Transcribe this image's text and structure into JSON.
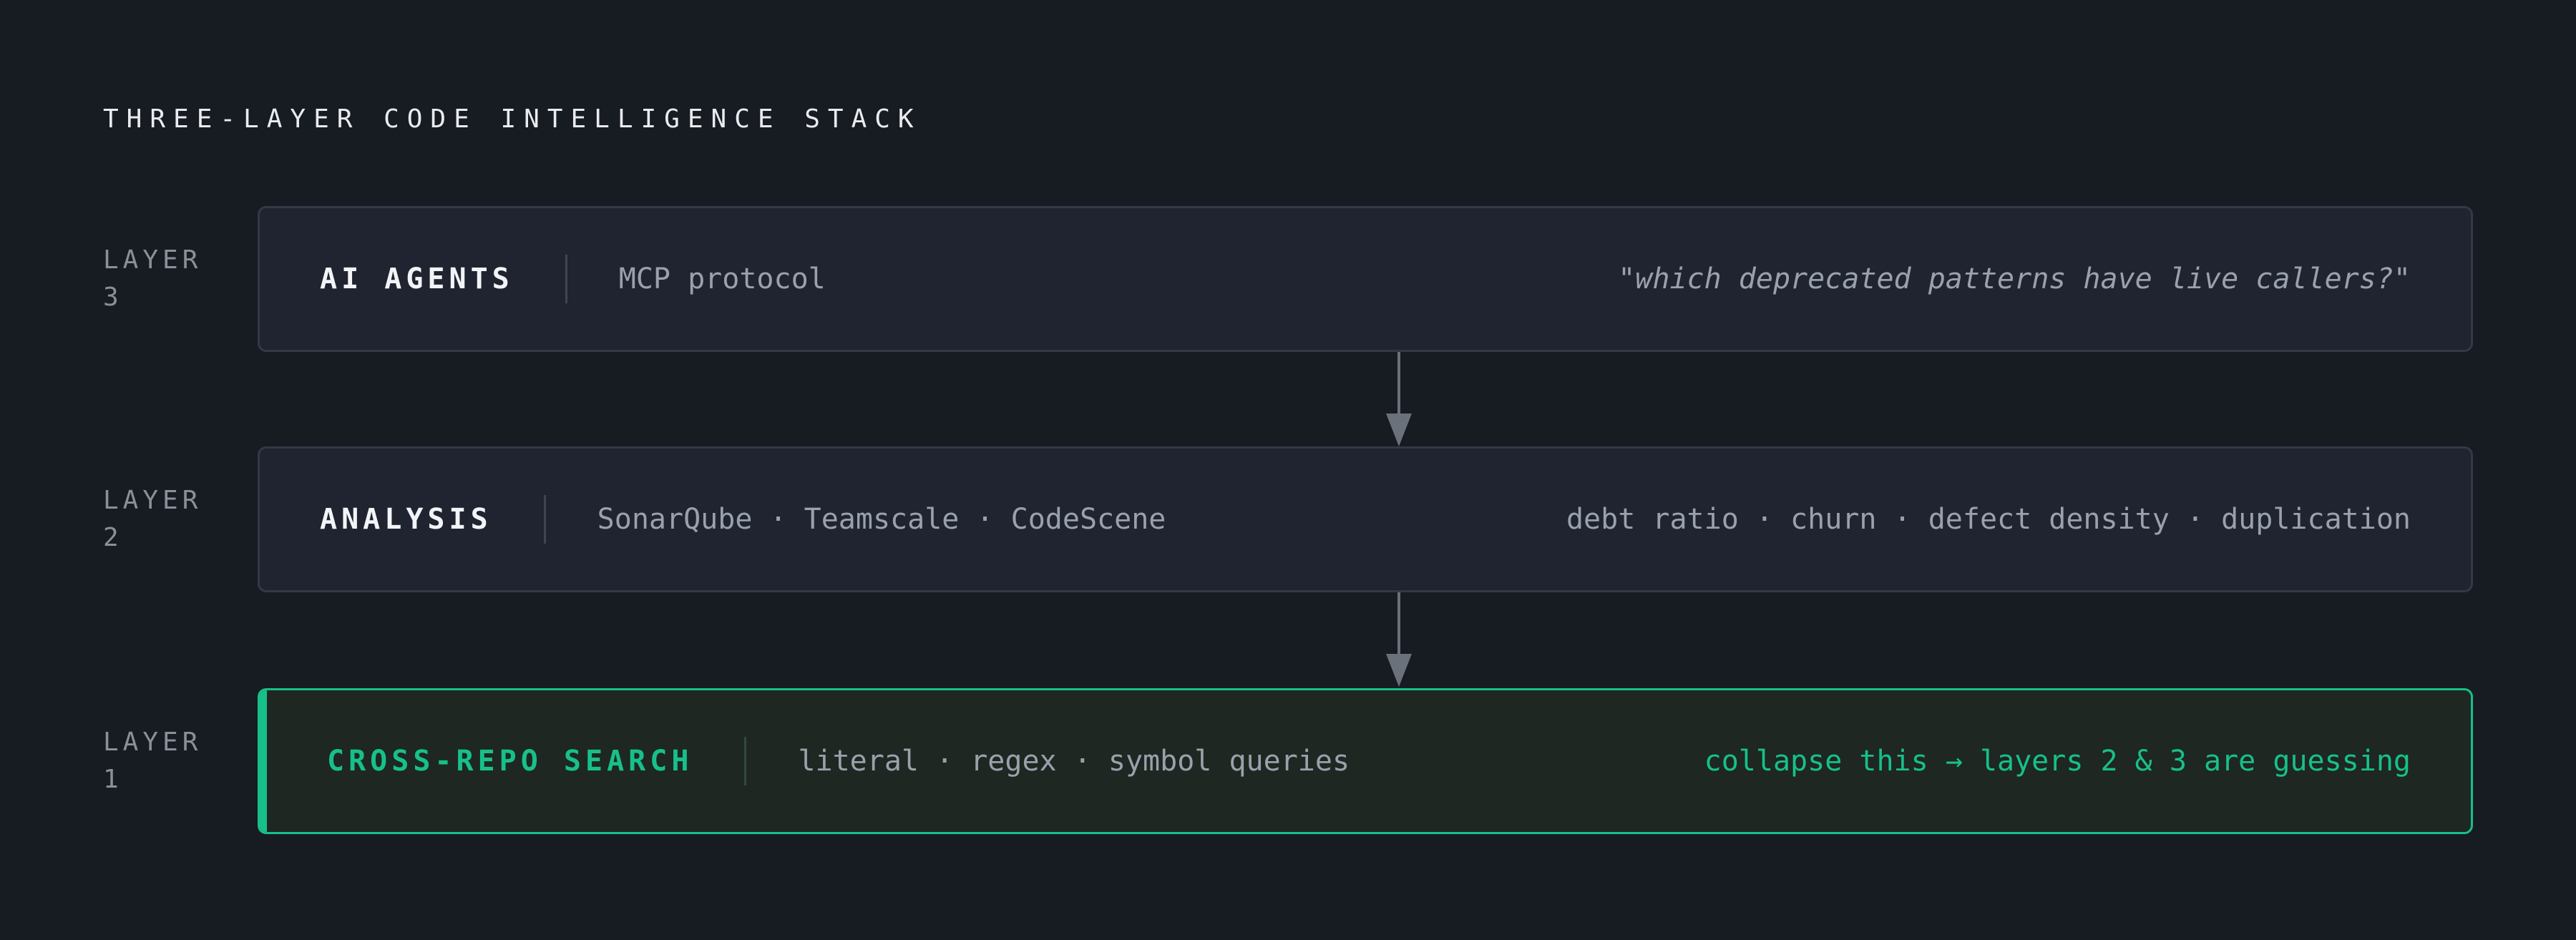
{
  "title": "THREE-LAYER CODE INTELLIGENCE STACK",
  "colors": {
    "background": "#171b22",
    "box": "#1f2430",
    "accent": "#17c08a",
    "arrow": "#6b717b"
  },
  "layers": [
    {
      "label_line1": "LAYER",
      "label_line2": "3",
      "name": "AI AGENTS",
      "tech": "MCP protocol",
      "note": "\"which deprecated patterns have live callers?\""
    },
    {
      "label_line1": "LAYER",
      "label_line2": "2",
      "name": "ANALYSIS",
      "tech": "SonarQube · Teamscale · CodeScene",
      "note": "debt ratio · churn · defect density · duplication"
    },
    {
      "label_line1": "LAYER",
      "label_line2": "1",
      "name": "CROSS-REPO SEARCH",
      "tech": "literal · regex · symbol queries",
      "note": "collapse this → layers 2 & 3 are guessing",
      "highlighted": true
    }
  ],
  "arrows": [
    {
      "from": "AI AGENTS",
      "to": "ANALYSIS",
      "icon": "arrow-down-icon"
    },
    {
      "from": "ANALYSIS",
      "to": "CROSS-REPO SEARCH",
      "icon": "arrow-down-icon"
    }
  ]
}
